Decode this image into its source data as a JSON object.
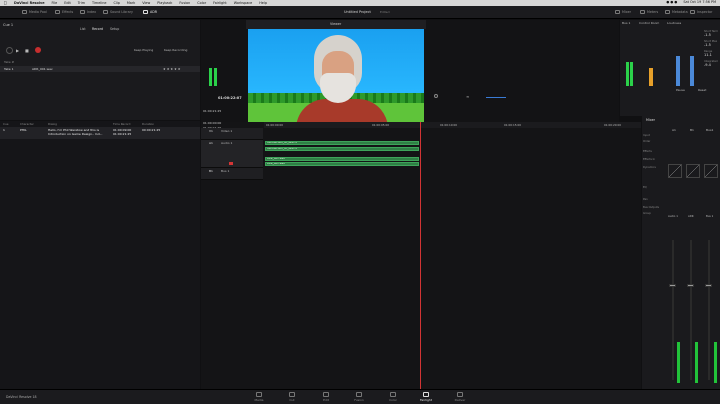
{
  "menubar": {
    "app": "DaVinci Resolve",
    "items": [
      "File",
      "Edit",
      "Trim",
      "Timeline",
      "Clip",
      "Mark",
      "View",
      "Playback",
      "Fusion",
      "Color",
      "Fairlight",
      "Workspace",
      "Help"
    ],
    "clock": "Sat Oct 19  7:56 PM"
  },
  "toolbar": {
    "left": [
      "Media Pool",
      "Effects",
      "Index",
      "Sound Library",
      "ADR"
    ],
    "title": "Untitled Project",
    "subtitle": "Edited",
    "right": [
      "Mixer",
      "Meters",
      "Metadata",
      "Inspector"
    ]
  },
  "adr": {
    "cue": "Cue 1",
    "tabs": [
      "List",
      "Record",
      "Setup"
    ],
    "keep_playing": "Keep Playing",
    "keep_recording": "Keep Recording",
    "take_header": "Take #",
    "take_row": {
      "id": "Take 1",
      "name": "ADR_001.wav"
    },
    "list_headers": [
      "Cue",
      "Character",
      "Dialog",
      "Time Record",
      "Duration"
    ],
    "list_row": {
      "cue": "1",
      "character": "PHIL",
      "dialog": "Hello, I'm Phil Wenzlow and this is",
      "dialog2": "Introduction on Game Design.. Ind...",
      "time": "01:00:09:00",
      "time2": "01:00:21:25",
      "duration": "00:00:21:25"
    }
  },
  "viewer": {
    "label": "Viewer",
    "timecode": "01:00:22:07"
  },
  "timeline": {
    "tc1": "01:00:00:00",
    "tc2": "01:00:21:25",
    "tc3": "01:00:21:25",
    "ruler": [
      "01:00:00:00",
      "01:00:05:00",
      "01:00:10:00",
      "01:00:15:00",
      "01:00:20:00"
    ],
    "tracks": [
      {
        "id": "V1",
        "name": "Video 1"
      },
      {
        "id": "A1",
        "name": "Audio 1"
      },
      {
        "id": "B1",
        "name": "Bus 1"
      }
    ],
    "clips": [
      "Introduction_on_GDE-4",
      "Introduction_on_GDE-4",
      "ADR_001.wav",
      "ADR_001.wav"
    ]
  },
  "meters": {
    "bus_label": "Bus 1",
    "control_room": "Control Room",
    "loudness": "Loudness",
    "lufs": [
      "-1.5",
      "-1.5",
      "11.1",
      "-9.4"
    ],
    "lufs_labels": [
      "Short Term",
      "Short Max",
      "Range",
      "Integrated"
    ],
    "pause": "Pause",
    "reset": "Reset"
  },
  "mixer": {
    "title": "Mixer",
    "channels": [
      "A1",
      "B1",
      "Bus1"
    ],
    "row_labels": [
      "Input",
      "Order",
      "Effects",
      "Effects In",
      "Dynamics",
      "EQ",
      "Pan",
      "Bus Outputs",
      "Group"
    ],
    "strip_names": [
      "Audio 1",
      "ADR",
      "Bus 1"
    ]
  },
  "pages": [
    "Media",
    "Cut",
    "Edit",
    "Fusion",
    "Color",
    "Fairlight",
    "Deliver"
  ],
  "brand": "DaVinci Resolve 18"
}
